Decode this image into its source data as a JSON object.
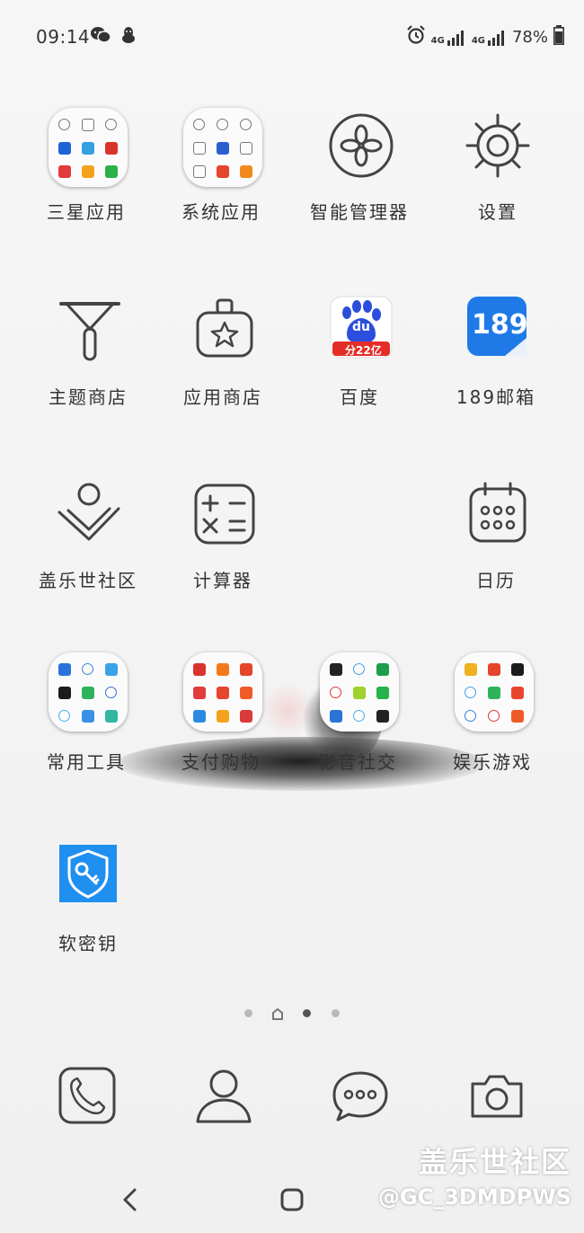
{
  "status_bar": {
    "time": "09:14",
    "left_icons": [
      "wechat-icon",
      "qq-icon"
    ],
    "right_icons": [
      "alarm-icon",
      "signal-4g-icon",
      "signal-4g-icon"
    ],
    "net_label_1": "4G",
    "net_label_2": "4G",
    "battery_percent": "78%",
    "battery_level": 0.78
  },
  "apps": [
    {
      "label": "三星应用",
      "type": "folder"
    },
    {
      "label": "系统应用",
      "type": "folder"
    },
    {
      "label": "智能管理器",
      "type": "app",
      "icon": "smart-manager-icon"
    },
    {
      "label": "设置",
      "type": "app",
      "icon": "gear-icon"
    },
    {
      "label": "主题商店",
      "type": "app",
      "icon": "theme-store-icon"
    },
    {
      "label": "应用商店",
      "type": "app",
      "icon": "app-store-icon"
    },
    {
      "label": "百度",
      "type": "app",
      "icon": "baidu-icon"
    },
    {
      "label": "189邮箱",
      "type": "app",
      "icon": "mail-189-icon"
    },
    {
      "label": "盖乐世社区",
      "type": "app",
      "icon": "galaxy-community-icon"
    },
    {
      "label": "计算器",
      "type": "app",
      "icon": "calculator-icon"
    },
    {
      "label": "日历",
      "type": "app",
      "icon": "calendar-icon"
    },
    {
      "label": "常用工具",
      "type": "folder"
    },
    {
      "label": "支付购物",
      "type": "folder"
    },
    {
      "label": "影音社交",
      "type": "folder"
    },
    {
      "label": "娱乐游戏",
      "type": "folder"
    },
    {
      "label": "软密钥",
      "type": "app",
      "icon": "soft-key-icon"
    }
  ],
  "baidu_badge": "du",
  "baidu_sub": "分22亿",
  "mail_189_text": "189",
  "page_indicator": {
    "count": 4,
    "current": 3,
    "home_page": 2
  },
  "dock": [
    "phone-icon",
    "contacts-icon",
    "messages-icon",
    "camera-icon"
  ],
  "nav": [
    "back-icon",
    "home-icon"
  ],
  "watermark": {
    "line1": "盖乐世社区",
    "line2": "@GC_3DMDPWS"
  },
  "colors": {
    "baidu_red": "#e52d27",
    "baidu_blue": "#2b4fdc",
    "mail_blue": "#1f7ae8",
    "softkey_blue": "#1f8ff0"
  }
}
